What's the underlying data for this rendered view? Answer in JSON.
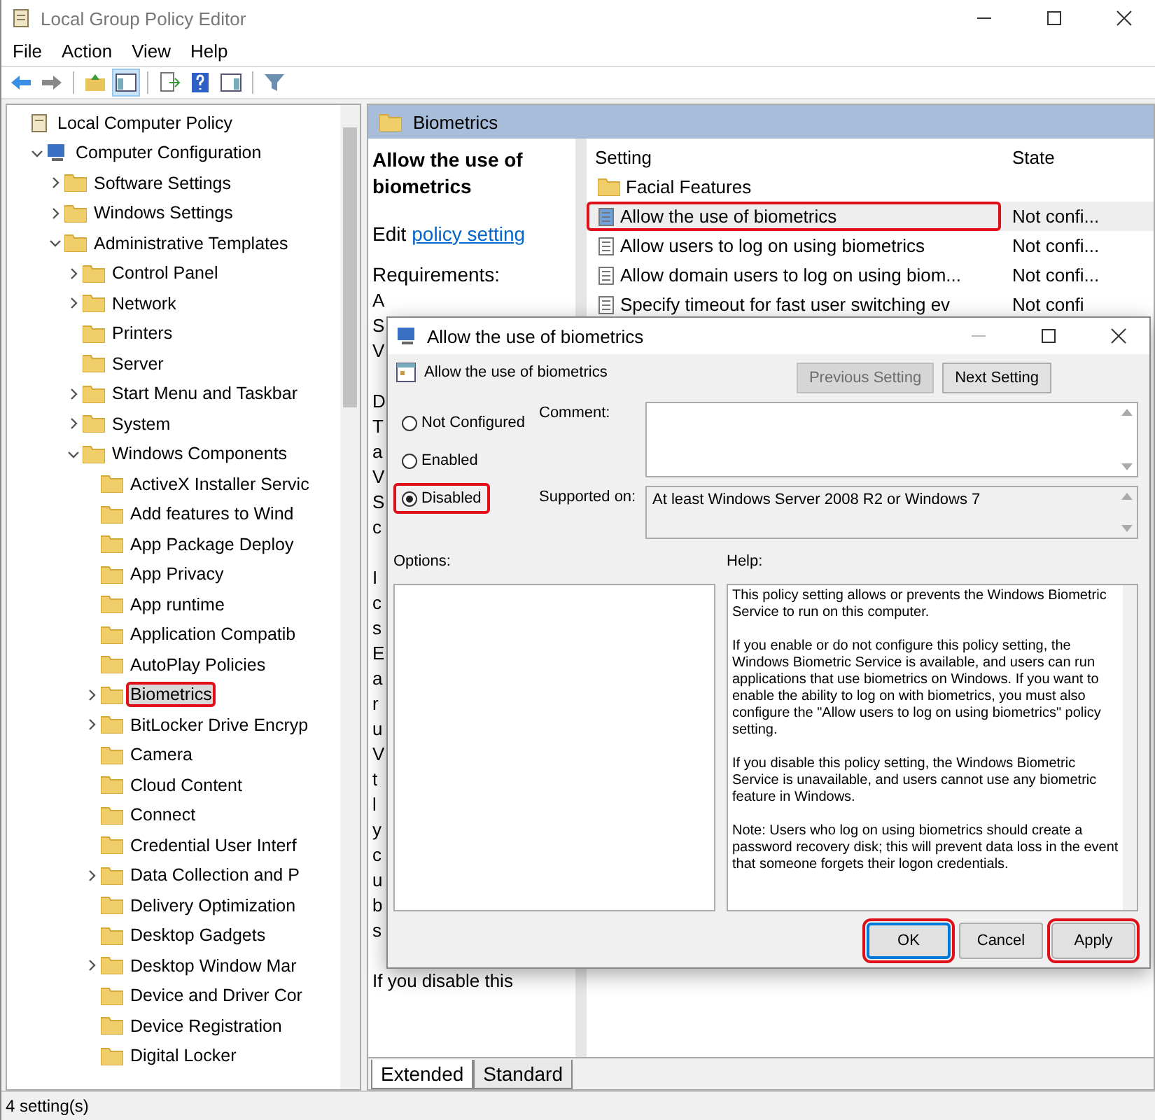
{
  "window": {
    "title": "Local Group Policy Editor"
  },
  "menu": [
    "File",
    "Action",
    "View",
    "Help"
  ],
  "toolbar": [
    [
      {
        "kind": "back",
        "pressed": false
      },
      {
        "kind": "forward",
        "pressed": false
      }
    ],
    [
      {
        "kind": "up",
        "pressed": false
      },
      {
        "kind": "tree",
        "pressed": true
      }
    ],
    [
      {
        "kind": "export",
        "pressed": false
      },
      {
        "kind": "help",
        "pressed": false
      },
      {
        "kind": "pane",
        "pressed": false
      }
    ],
    [
      {
        "kind": "filter",
        "pressed": false
      }
    ]
  ],
  "tree": [
    {
      "label": "Local Computer Policy",
      "kind": "policy",
      "selected": false,
      "annotated": false,
      "children": [
        {
          "label": "Computer Configuration",
          "kind": "computer",
          "expanded": true,
          "selected": false,
          "annotated": false,
          "children": [
            {
              "label": "Software Settings",
              "kind": "folder",
              "expanded": false,
              "selected": false,
              "annotated": false
            },
            {
              "label": "Windows Settings",
              "kind": "folder",
              "expanded": false,
              "selected": false,
              "annotated": false
            },
            {
              "label": "Administrative Templates",
              "kind": "folder",
              "expanded": true,
              "selected": false,
              "annotated": false,
              "children": [
                {
                  "label": "Control Panel",
                  "kind": "folder",
                  "expanded": false,
                  "selected": false,
                  "annotated": false
                },
                {
                  "label": "Network",
                  "kind": "folder",
                  "expanded": false,
                  "selected": false,
                  "annotated": false
                },
                {
                  "label": "Printers",
                  "kind": "folder",
                  "selected": false,
                  "annotated": false
                },
                {
                  "label": "Server",
                  "kind": "folder",
                  "selected": false,
                  "annotated": false
                },
                {
                  "label": "Start Menu and Taskbar",
                  "kind": "folder",
                  "expanded": false,
                  "selected": false,
                  "annotated": false
                },
                {
                  "label": "System",
                  "kind": "folder",
                  "expanded": false,
                  "selected": false,
                  "annotated": false
                },
                {
                  "label": "Windows Components",
                  "kind": "folder",
                  "expanded": true,
                  "selected": false,
                  "annotated": false,
                  "children": [
                    {
                      "label": "ActiveX Installer Servic",
                      "kind": "folder",
                      "selected": false,
                      "annotated": false
                    },
                    {
                      "label": "Add features to Wind",
                      "kind": "folder",
                      "selected": false,
                      "annotated": false
                    },
                    {
                      "label": "App Package Deploy",
                      "kind": "folder",
                      "selected": false,
                      "annotated": false
                    },
                    {
                      "label": "App Privacy",
                      "kind": "folder",
                      "selected": false,
                      "annotated": false
                    },
                    {
                      "label": "App runtime",
                      "kind": "folder",
                      "selected": false,
                      "annotated": false
                    },
                    {
                      "label": "Application Compatib",
                      "kind": "folder",
                      "selected": false,
                      "annotated": false
                    },
                    {
                      "label": "AutoPlay Policies",
                      "kind": "folder",
                      "selected": false,
                      "annotated": false
                    },
                    {
                      "label": "Biometrics",
                      "kind": "folder",
                      "expanded": false,
                      "selected": true,
                      "annotated": true
                    },
                    {
                      "label": "BitLocker Drive Encryp",
                      "kind": "folder",
                      "expanded": false,
                      "selected": false,
                      "annotated": false
                    },
                    {
                      "label": "Camera",
                      "kind": "folder",
                      "selected": false,
                      "annotated": false
                    },
                    {
                      "label": "Cloud Content",
                      "kind": "folder",
                      "selected": false,
                      "annotated": false
                    },
                    {
                      "label": "Connect",
                      "kind": "folder",
                      "selected": false,
                      "annotated": false
                    },
                    {
                      "label": "Credential User Interf",
                      "kind": "folder",
                      "selected": false,
                      "annotated": false
                    },
                    {
                      "label": "Data Collection and P",
                      "kind": "folder",
                      "expanded": false,
                      "selected": false,
                      "annotated": false
                    },
                    {
                      "label": "Delivery Optimization",
                      "kind": "folder",
                      "selected": false,
                      "annotated": false
                    },
                    {
                      "label": "Desktop Gadgets",
                      "kind": "folder",
                      "selected": false,
                      "annotated": false
                    },
                    {
                      "label": "Desktop Window Mar",
                      "kind": "folder",
                      "expanded": false,
                      "selected": false,
                      "annotated": false
                    },
                    {
                      "label": "Device and Driver Cor",
                      "kind": "folder",
                      "selected": false,
                      "annotated": false
                    },
                    {
                      "label": "Device Registration",
                      "kind": "folder",
                      "selected": false,
                      "annotated": false
                    },
                    {
                      "label": "Digital Locker",
                      "kind": "folder",
                      "selected": false,
                      "annotated": false
                    }
                  ]
                }
              ]
            }
          ]
        }
      ]
    }
  ],
  "panel": {
    "title": "Biometrics",
    "description": {
      "title": "Allow the use of biometrics",
      "edit": "Edit",
      "link": "policy setting",
      "requirements": "Requirements:",
      "paragraphs": [
        [
          "A",
          "S",
          "V"
        ],
        [
          "D",
          "T",
          "a",
          "V",
          "S",
          "c"
        ],
        [
          "I",
          "c",
          "s",
          "E",
          "a",
          "r",
          "u",
          "V",
          "t",
          "l",
          "y",
          "c",
          "u",
          "b",
          "s"
        ],
        [
          "If you disable this"
        ]
      ]
    },
    "list": {
      "columns": [
        "Setting",
        "State"
      ],
      "rows": [
        {
          "kind": "folder",
          "name": "Facial Features",
          "state": "",
          "selected": false,
          "annotated": false
        },
        {
          "kind": "policy",
          "name": "Allow the use of biometrics",
          "state": "Not confi...",
          "selected": true,
          "annotated": true
        },
        {
          "kind": "policy",
          "name": "Allow users to log on using biometrics",
          "state": "Not confi...",
          "selected": false,
          "annotated": false
        },
        {
          "kind": "policy",
          "name": "Allow domain users to log on using biom...",
          "state": "Not confi...",
          "selected": false,
          "annotated": false
        },
        {
          "kind": "policy",
          "name": "Specify timeout for fast user switching ev",
          "state": "Not confi",
          "selected": false,
          "annotated": false
        }
      ]
    },
    "tabs": [
      {
        "label": "Extended",
        "selected": true
      },
      {
        "label": "Standard",
        "selected": false
      }
    ]
  },
  "status_bar": "4 setting(s)",
  "dialog": {
    "title": "Allow the use of biometrics",
    "heading": "Allow the use of biometrics",
    "nav": [
      {
        "label": "Previous Setting",
        "disabled": true
      },
      {
        "label": "Next Setting",
        "disabled": false
      }
    ],
    "options": [
      {
        "label": "Not Configured",
        "selected": false,
        "annotated": false
      },
      {
        "label": "Enabled",
        "selected": false,
        "annotated": false
      },
      {
        "label": "Disabled",
        "selected": true,
        "annotated": true
      }
    ],
    "comment_label": "Comment:",
    "supported_label": "Supported on:",
    "supported": "At least Windows Server 2008 R2 or Windows 7",
    "options_label": "Options:",
    "help_label": "Help:",
    "help": [
      "This policy setting allows or prevents the Windows Biometric Service to run on this computer.",
      "If you enable or do not configure this policy setting, the Windows Biometric Service is available, and users can run applications that use biometrics on Windows. If you want to enable the ability to log on with biometrics, you must also configure the \"Allow users to log on using biometrics\" policy setting.",
      "If you disable this policy setting, the Windows Biometric Service is unavailable, and users cannot use any biometric feature in Windows.",
      "Note: Users who log on using biometrics should create a password recovery disk; this will prevent data loss in the event that someone forgets their logon credentials."
    ],
    "buttons": [
      {
        "label": "OK",
        "focused": true,
        "annotated": true
      },
      {
        "label": "Cancel",
        "focused": false,
        "annotated": false
      },
      {
        "label": "Apply",
        "focused": false,
        "annotated": true
      }
    ]
  }
}
